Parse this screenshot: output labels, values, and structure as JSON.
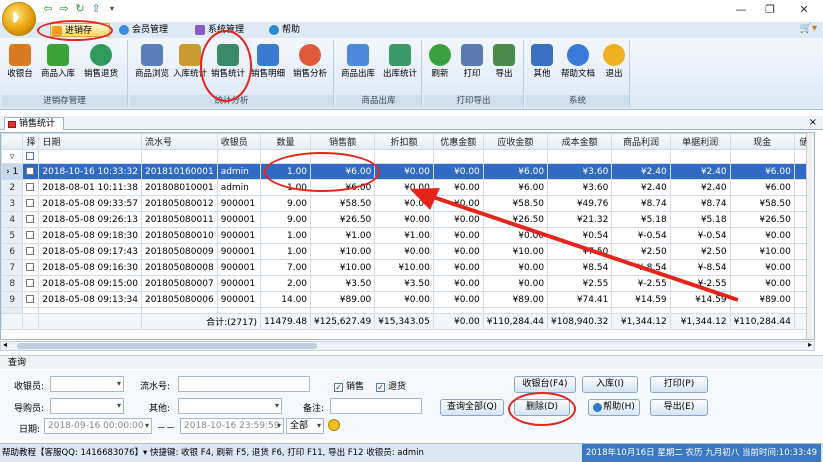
{
  "titlebar": {
    "minimize": "—",
    "maximize": "❐",
    "close": "✕",
    "quick_arrow": "▾"
  },
  "menus": [
    {
      "label": "进销存",
      "color": "#f0a020"
    },
    {
      "label": "会员管理",
      "color": "#3a8de0"
    },
    {
      "label": "系统管理",
      "color": "#8a5ac8"
    },
    {
      "label": "帮助",
      "color": "#2a8ad0"
    }
  ],
  "menu_right": "▾",
  "ribbon": {
    "groups": [
      {
        "label": "进销存管理"
      },
      {
        "label": "统计分析"
      },
      {
        "label": "商品出库"
      },
      {
        "label": "打印导出"
      },
      {
        "label": "系统"
      }
    ],
    "buttons": [
      {
        "label": "收银台",
        "color": "#d87a20"
      },
      {
        "label": "商品入库",
        "color": "#3aa33a"
      },
      {
        "label": "销售退货",
        "color": "#2f9a5a"
      },
      {
        "label": "商品浏览",
        "color": "#5a7fb8"
      },
      {
        "label": "入库统计",
        "color": "#c89a30"
      },
      {
        "label": "销售统计",
        "color": "#3a8a6a"
      },
      {
        "label": "销售明细",
        "color": "#3a7ad0"
      },
      {
        "label": "销售分析",
        "color": "#e05a3a"
      },
      {
        "label": "商品出库",
        "color": "#4a8ad8"
      },
      {
        "label": "出库统计",
        "color": "#3a9a6a"
      },
      {
        "label": "刷新",
        "color": "#3aa040"
      },
      {
        "label": "打印",
        "color": "#5a7ab0"
      },
      {
        "label": "导出",
        "color": "#4a8a4a"
      },
      {
        "label": "其他",
        "color": "#3a70c0"
      },
      {
        "label": "帮助文档",
        "color": "#3a7ad8"
      },
      {
        "label": "退出",
        "color": "#f0b020"
      }
    ]
  },
  "tab": {
    "label": "销售统计",
    "close": "×"
  },
  "table": {
    "columns": [
      "择",
      "日期",
      "流水号",
      "收银员",
      "数量",
      "销售额",
      "折扣额",
      "优惠金额",
      "应收金额",
      "成本金额",
      "商品利润",
      "单据利润",
      "现金",
      "储"
    ],
    "rows": [
      {
        "no": "1",
        "date": "2018-10-16 10:33:32",
        "sn": "201810160001",
        "cashier": "admin",
        "qty": "1.00",
        "sales": "¥6.00",
        "disc": "¥0.00",
        "promo": "¥0.00",
        "recv": "¥6.00",
        "cost": "¥3.60",
        "gp": "¥2.40",
        "bp": "¥2.40",
        "cash": "¥6.00",
        "selected": true
      },
      {
        "no": "2",
        "date": "2018-08-01 10:11:38",
        "sn": "201808010001",
        "cashier": "admin",
        "qty": "1.00",
        "sales": "¥6.00",
        "disc": "¥0.00",
        "promo": "¥0.00",
        "recv": "¥6.00",
        "cost": "¥3.60",
        "gp": "¥2.40",
        "bp": "¥2.40",
        "cash": "¥6.00"
      },
      {
        "no": "3",
        "date": "2018-05-08 09:33:57",
        "sn": "201805080012",
        "cashier": "900001",
        "qty": "9.00",
        "sales": "¥58.50",
        "disc": "¥0.00",
        "promo": "¥0.00",
        "recv": "¥58.50",
        "cost": "¥49.76",
        "gp": "¥8.74",
        "bp": "¥8.74",
        "cash": "¥58.50"
      },
      {
        "no": "4",
        "date": "2018-05-08 09:26:13",
        "sn": "201805080011",
        "cashier": "900001",
        "qty": "9.00",
        "sales": "¥26.50",
        "disc": "¥0.00",
        "promo": "¥0.00",
        "recv": "¥26.50",
        "cost": "¥21.32",
        "gp": "¥5.18",
        "bp": "¥5.18",
        "cash": "¥26.50"
      },
      {
        "no": "5",
        "date": "2018-05-08 09:18:30",
        "sn": "201805080010",
        "cashier": "900001",
        "qty": "1.00",
        "sales": "¥1.00",
        "disc": "¥1.00",
        "promo": "¥0.00",
        "recv": "¥0.00",
        "cost": "¥0.54",
        "gp": "¥-0.54",
        "bp": "¥-0.54",
        "cash": "¥0.00"
      },
      {
        "no": "6",
        "date": "2018-05-08 09:17:43",
        "sn": "201805080009",
        "cashier": "900001",
        "qty": "1.00",
        "sales": "¥10.00",
        "disc": "¥0.00",
        "promo": "¥0.00",
        "recv": "¥10.00",
        "cost": "¥7.50",
        "gp": "¥2.50",
        "bp": "¥2.50",
        "cash": "¥10.00"
      },
      {
        "no": "7",
        "date": "2018-05-08 09:16:30",
        "sn": "201805080008",
        "cashier": "900001",
        "qty": "7.00",
        "sales": "¥10.00",
        "disc": "¥10.00",
        "promo": "¥0.00",
        "recv": "¥0.00",
        "cost": "¥8.54",
        "gp": "¥-8.54",
        "bp": "¥-8.54",
        "cash": "¥0.00"
      },
      {
        "no": "8",
        "date": "2018-05-08 09:15:00",
        "sn": "201805080007",
        "cashier": "900001",
        "qty": "2.00",
        "sales": "¥3.50",
        "disc": "¥3.50",
        "promo": "¥0.00",
        "recv": "¥0.00",
        "cost": "¥2.55",
        "gp": "¥-2.55",
        "bp": "¥-2.55",
        "cash": "¥0.00"
      },
      {
        "no": "9",
        "date": "2018-05-08 09:13:34",
        "sn": "201805080006",
        "cashier": "900001",
        "qty": "14.00",
        "sales": "¥89.00",
        "disc": "¥0.00",
        "promo": "¥0.00",
        "recv": "¥89.00",
        "cost": "¥74.41",
        "gp": "¥14.59",
        "bp": "¥14.59",
        "cash": "¥89.00"
      }
    ],
    "summary": {
      "label": "合计:(2717)",
      "qty": "11479.48",
      "sales": "¥125,627.49",
      "disc": "¥15,343.05",
      "promo": "¥0.00",
      "recv": "¥110,284.44",
      "cost": "¥108,940.32",
      "gp": "¥1,344.12",
      "bp": "¥1,344.12",
      "cash": "¥110,284.44"
    }
  },
  "query": {
    "header": "查询",
    "cashier_label": "收银员:",
    "sn_label": "流水号:",
    "guide_label": "导购员:",
    "other_label": "其他:",
    "note_label": "备注:",
    "date_label": "日期:",
    "date_from": "2018-09-16 00:00:00",
    "date_to": "2018-10-16 23:59:59",
    "date_sep": "－－",
    "scope": "全部",
    "chk_sales": "销售",
    "chk_return": "退货",
    "btn_cashier": "收银台(F4)",
    "btn_instock": "入库(I)",
    "btn_print": "打印(P)",
    "btn_query_all": "查询全部(Q)",
    "btn_delete": "删除(D)",
    "btn_help": "帮助(H)",
    "btn_export": "导出(E)"
  },
  "status": {
    "left": "帮助教程【客服QQ: 1416683076】▾  快捷键: 收银 F4, 刷新 F5, 退货 F6, 打印 F11, 导出 F12  收银员: admin",
    "right": "2018年10月16日 星期二 农历 九月初八 当前时间:10:33:49"
  }
}
